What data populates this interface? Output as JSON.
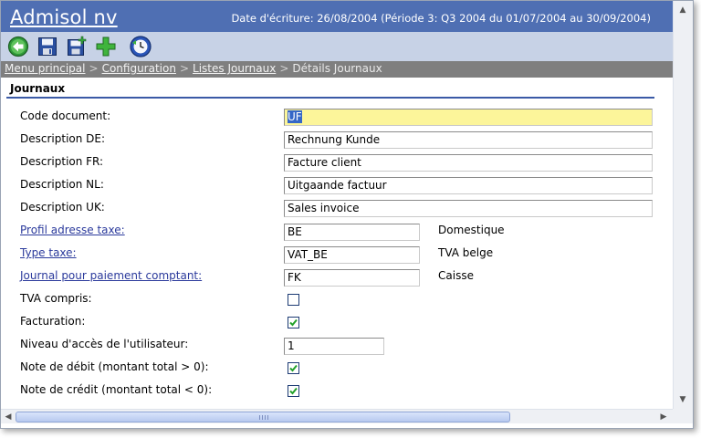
{
  "header": {
    "title": "Admisol nv",
    "date_info": "Date d'écriture: 26/08/2004 (Période 3: Q3 2004 du 01/07/2004 au 30/09/2004)"
  },
  "toolbar": {
    "buttons": [
      {
        "icon": "back-arrow-icon",
        "label": "Retour"
      },
      {
        "icon": "save-icon",
        "label": "Enregistrer"
      },
      {
        "icon": "save-new-icon",
        "label": "Enregistrer et nouveau"
      },
      {
        "icon": "add-icon",
        "label": "Ajouter"
      },
      {
        "icon": "refresh-clock-icon",
        "label": "Historique"
      }
    ]
  },
  "breadcrumb": {
    "items": [
      "Menu principal",
      "Configuration",
      "Listes Journaux"
    ],
    "current": "Détails Journaux",
    "separator": ">"
  },
  "section": {
    "title": "Journaux"
  },
  "form": {
    "code_document": {
      "label": "Code document:",
      "value": "UF"
    },
    "description_de": {
      "label": "Description DE:",
      "value": "Rechnung Kunde"
    },
    "description_fr": {
      "label": "Description FR:",
      "value": "Facture client"
    },
    "description_nl": {
      "label": "Description NL:",
      "value": "Uitgaande factuur"
    },
    "description_uk": {
      "label": "Description UK:",
      "value": "Sales invoice"
    },
    "profil_adresse_taxe": {
      "label": "Profil adresse taxe:",
      "value": "BE",
      "description": "Domestique"
    },
    "type_taxe": {
      "label": "Type taxe:",
      "value": "VAT_BE",
      "description": "TVA belge"
    },
    "journal_paiement": {
      "label": "Journal pour paiement comptant:",
      "value": "FK",
      "description": "Caisse"
    },
    "tva_compris": {
      "label": "TVA compris:",
      "checked": false
    },
    "facturation": {
      "label": "Facturation:",
      "checked": true
    },
    "niveau_acces": {
      "label": "Niveau d'accès de l'utilisateur:",
      "value": "1"
    },
    "note_debit": {
      "label": "Note de débit (montant total > 0):",
      "checked": true
    },
    "note_credit": {
      "label": "Note de crédit (montant total < 0):",
      "checked": true
    }
  },
  "colors": {
    "header_bg": "#4f6fb3",
    "toolbar_bg": "#c7d2e6",
    "breadcrumb_bg": "#7f7f7f",
    "focused_field_bg": "#fcf59a",
    "link": "#2b3a9c"
  }
}
